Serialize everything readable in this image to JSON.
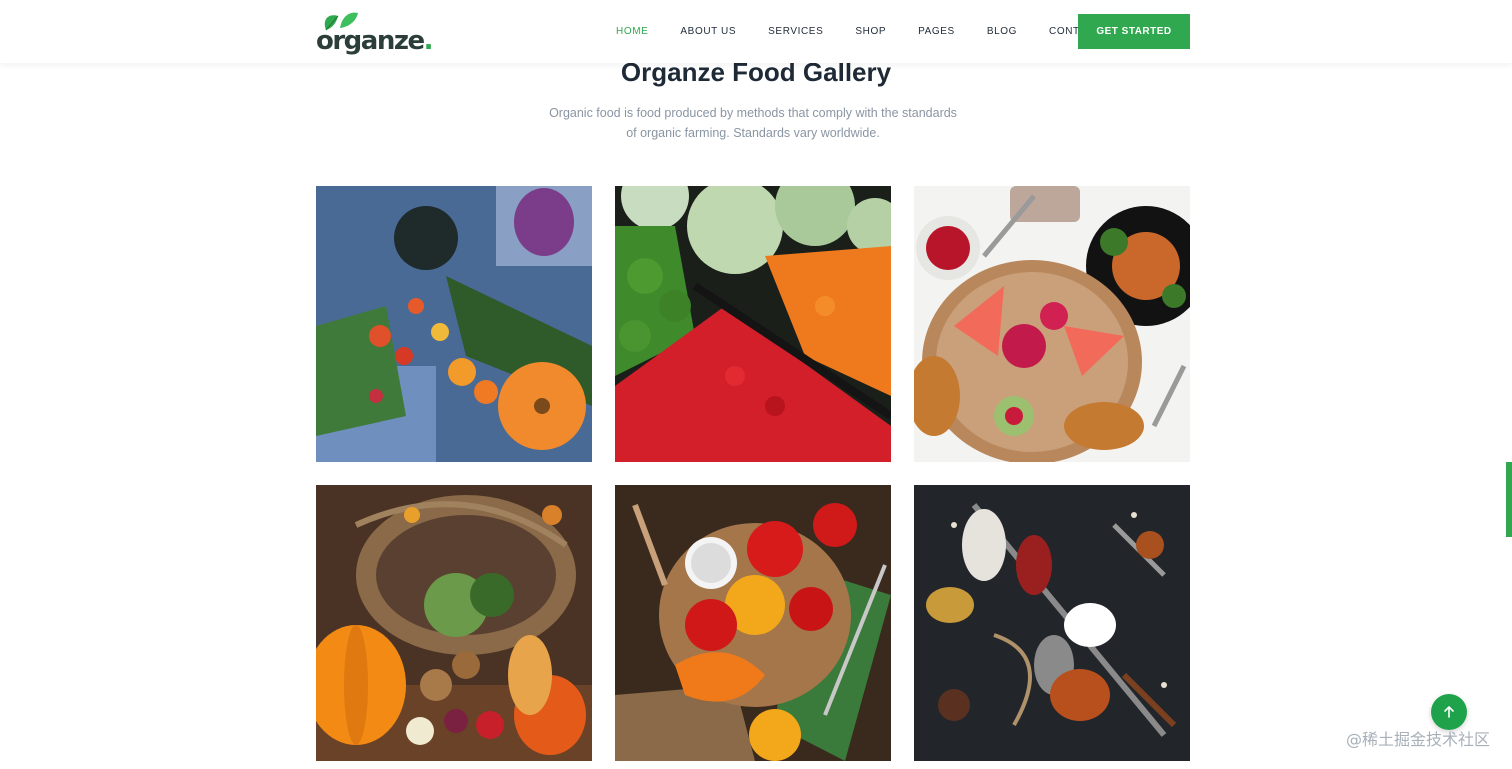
{
  "brand": {
    "name": "organze",
    "dot": "."
  },
  "nav": {
    "items": [
      "HOME",
      "ABOUT US",
      "SERVICES",
      "SHOP",
      "PAGES",
      "BLOG",
      "CONTACT"
    ],
    "active": "HOME",
    "cta": "GET STARTED"
  },
  "section": {
    "title": "Organze Food Gallery",
    "subtitle": "Organic food is food produced by methods that comply with the standards of organic farming. Standards vary worldwide."
  },
  "gallery": {
    "images": [
      "vegetables-on-blue-cloth-photo",
      "cabbage-and-peppers-market-photo",
      "fruit-platter-and-pasta-photo",
      "harvest-basket-with-pumpkins-photo",
      "tomatoes-and-peppers-on-board-photo",
      "spices-on-spoons-photo"
    ]
  },
  "ui": {
    "back_to_top_icon": "arrow-up-icon",
    "accent": "#2fa84f"
  },
  "watermark": "@稀土掘金技术社区"
}
